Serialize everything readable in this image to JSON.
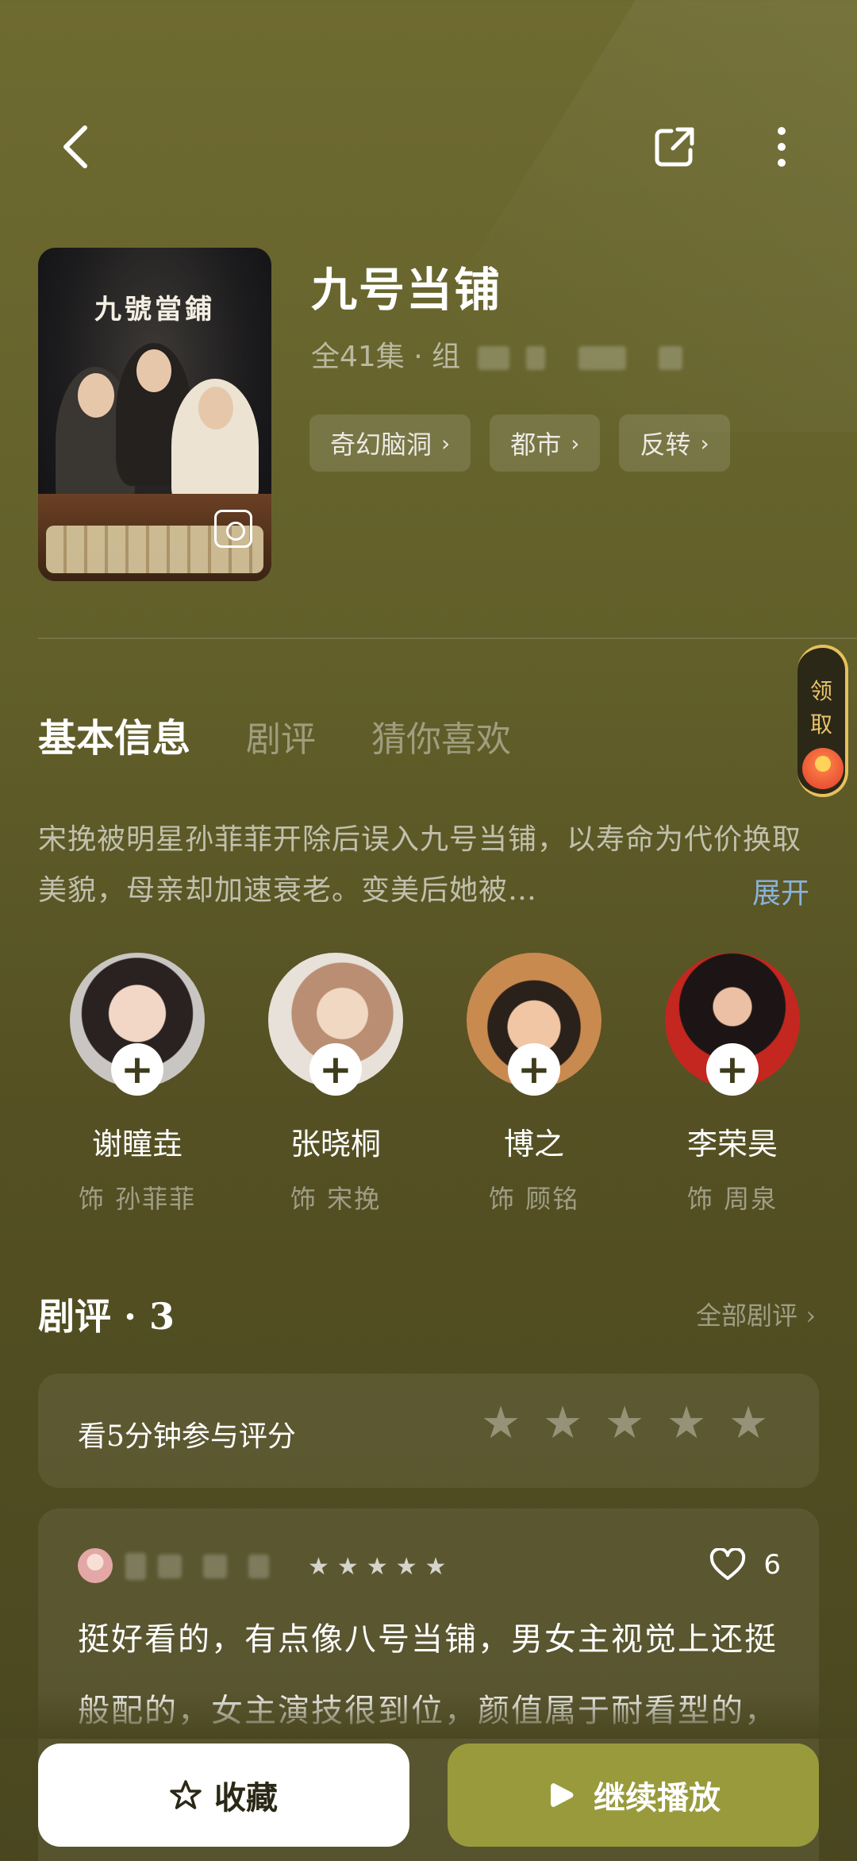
{
  "header": {
    "title": "九号当铺",
    "episodes": "全41集 · 组",
    "tags": [
      {
        "label": "奇幻脑洞"
      },
      {
        "label": "都市"
      },
      {
        "label": "反转"
      }
    ],
    "poster_title": "九號當鋪"
  },
  "reward": {
    "label": "领取"
  },
  "tabs": [
    {
      "label": "基本信息",
      "active": true
    },
    {
      "label": "剧评",
      "active": false
    },
    {
      "label": "猜你喜欢",
      "active": false
    }
  ],
  "synopsis": {
    "text": "宋挽被明星孙菲菲开除后误入九号当铺，以寿命为代价换取美貌，母亲却加速衰老。变美后她被…",
    "expand_label": "展开"
  },
  "cast": [
    {
      "name": "谢瞳垚",
      "role": "饰 孙菲菲"
    },
    {
      "name": "张晓桐",
      "role": "饰 宋挽"
    },
    {
      "name": "博之",
      "role": "饰 顾铭"
    },
    {
      "name": "李荣昊",
      "role": "饰 周泉"
    }
  ],
  "reviews": {
    "title": "剧评 · 3",
    "all_label": "全部剧评 ›",
    "rate_prompt": "看5分钟参与评分",
    "first": {
      "likes": "6",
      "text": "挺好看的，有点像八号当铺，男女主视觉上还挺般配的，女主演技很到位，颜值属于耐看型的，越看越好看"
    }
  },
  "bottom": {
    "favorite_label": "收藏",
    "play_label": "继续播放"
  }
}
